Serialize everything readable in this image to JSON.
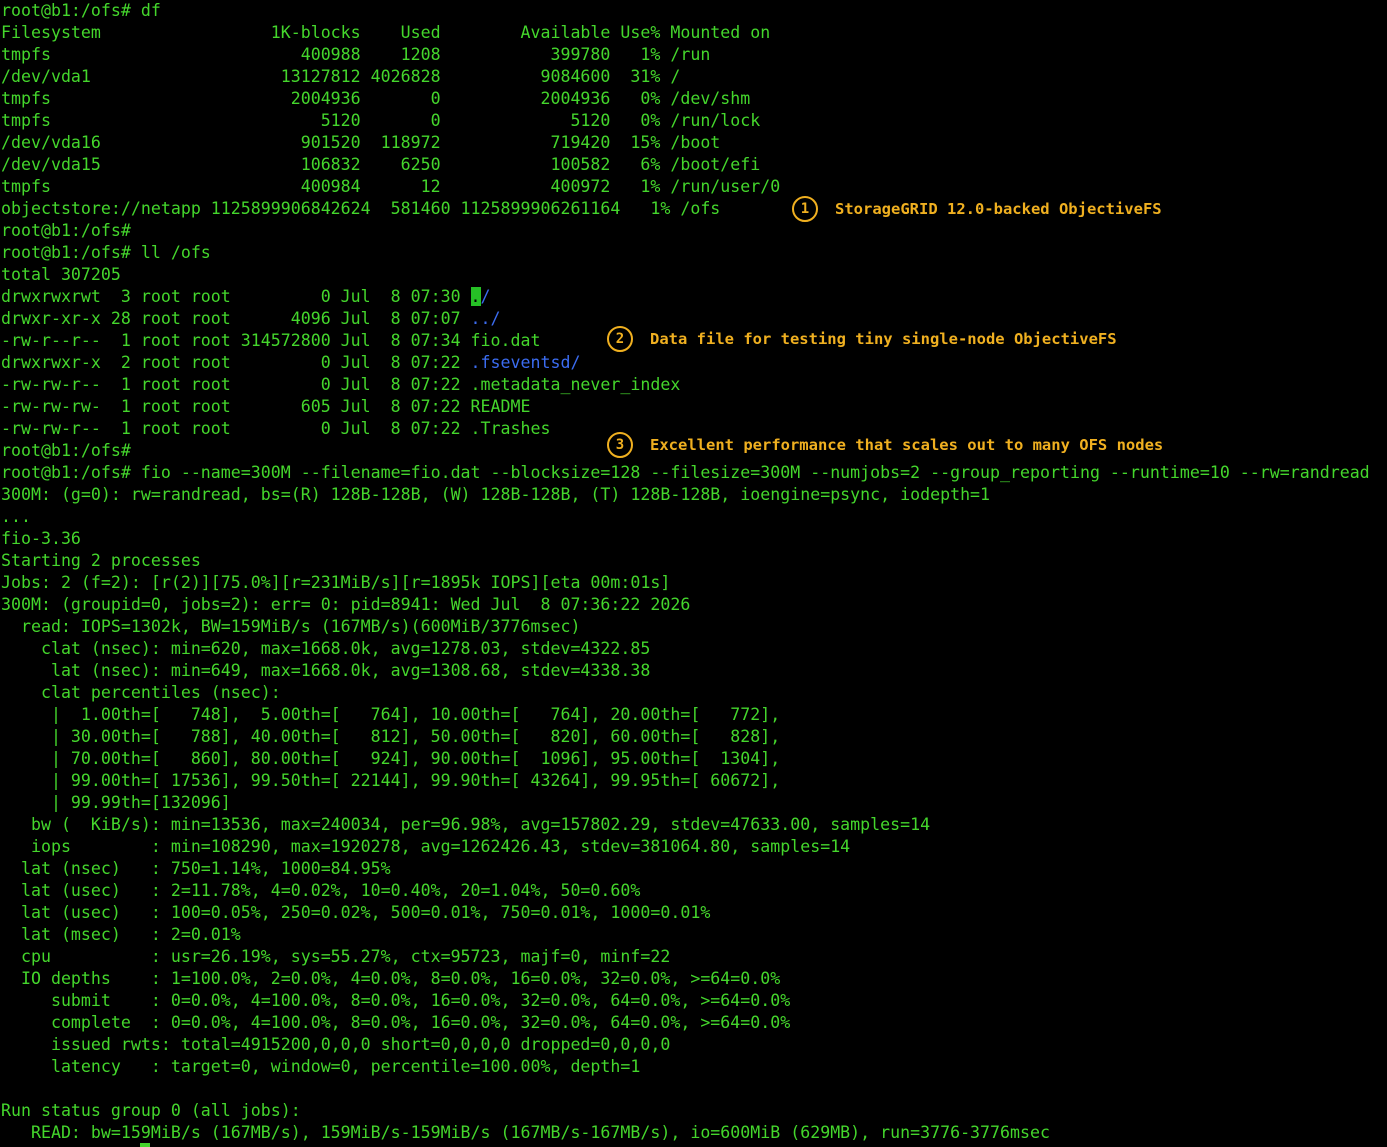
{
  "terminal": {
    "lines": [
      [
        "root@b1:/ofs# df"
      ],
      [
        "Filesystem                 1K-blocks    Used        Available Use% Mounted on"
      ],
      [
        "tmpfs                         400988    1208           399780   1% /run"
      ],
      [
        "/dev/vda1                   13127812 4026828          9084600  31% /"
      ],
      [
        "tmpfs                        2004936       0          2004936   0% /dev/shm"
      ],
      [
        "tmpfs                           5120       0             5120   0% /run/lock"
      ],
      [
        "/dev/vda16                    901520  118972           719420  15% /boot"
      ],
      [
        "/dev/vda15                    106832    6250           100582   6% /boot/efi"
      ],
      [
        "tmpfs                         400984      12           400972   1% /run/user/0"
      ],
      [
        "objectstore://netapp 1125899906842624  581460 1125899906261164   1% /ofs"
      ],
      [
        "root@b1:/ofs#"
      ],
      [
        "root@b1:/ofs# ll /ofs"
      ],
      [
        "total 307205"
      ],
      [
        "drwxrwxrwt  3 root root         0 Jul  8 07:30 ",
        {
          "t": ".",
          "c": "hl"
        },
        {
          "t": "/",
          "c": "dir"
        }
      ],
      [
        "drwxr-xr-x 28 root root      4096 Jul  8 07:07 ",
        {
          "t": "../",
          "c": "dir"
        }
      ],
      [
        "-rw-r--r--  1 root root 314572800 Jul  8 07:34 fio.dat"
      ],
      [
        "drwxrwxr-x  2 root root         0 Jul  8 07:22 ",
        {
          "t": ".fseventsd/",
          "c": "dir"
        }
      ],
      [
        "-rw-rw-r--  1 root root         0 Jul  8 07:22 .metadata_never_index"
      ],
      [
        "-rw-rw-rw-  1 root root       605 Jul  8 07:22 README"
      ],
      [
        "-rw-rw-r--  1 root root         0 Jul  8 07:22 .Trashes"
      ],
      [
        "root@b1:/ofs#"
      ],
      [
        "root@b1:/ofs# fio --name=300M --filename=fio.dat --blocksize=128 --filesize=300M --numjobs=2 --group_reporting --runtime=10 --rw=randread"
      ],
      [
        "300M: (g=0): rw=randread, bs=(R) 128B-128B, (W) 128B-128B, (T) 128B-128B, ioengine=psync, iodepth=1"
      ],
      [
        "..."
      ],
      [
        "fio-3.36"
      ],
      [
        "Starting 2 processes"
      ],
      [
        "Jobs: 2 (f=2): [r(2)][75.0%][r=231MiB/s][r=1895k IOPS][eta 00m:01s]"
      ],
      [
        "300M: (groupid=0, jobs=2): err= 0: pid=8941: Wed Jul  8 07:36:22 2026"
      ],
      [
        "  read: IOPS=1302k, BW=159MiB/s (167MB/s)(600MiB/3776msec)"
      ],
      [
        "    clat (nsec): min=620, max=1668.0k, avg=1278.03, stdev=4322.85"
      ],
      [
        "     lat (nsec): min=649, max=1668.0k, avg=1308.68, stdev=4338.38"
      ],
      [
        "    clat percentiles (nsec):"
      ],
      [
        "     |  1.00th=[   748],  5.00th=[   764], 10.00th=[   764], 20.00th=[   772],"
      ],
      [
        "     | 30.00th=[   788], 40.00th=[   812], 50.00th=[   820], 60.00th=[   828],"
      ],
      [
        "     | 70.00th=[   860], 80.00th=[   924], 90.00th=[  1096], 95.00th=[  1304],"
      ],
      [
        "     | 99.00th=[ 17536], 99.50th=[ 22144], 99.90th=[ 43264], 99.95th=[ 60672],"
      ],
      [
        "     | 99.99th=[132096]"
      ],
      [
        "   bw (  KiB/s): min=13536, max=240034, per=96.98%, avg=157802.29, stdev=47633.00, samples=14"
      ],
      [
        "   iops        : min=108290, max=1920278, avg=1262426.43, stdev=381064.80, samples=14"
      ],
      [
        "  lat (nsec)   : 750=1.14%, 1000=84.95%"
      ],
      [
        "  lat (usec)   : 2=11.78%, 4=0.02%, 10=0.40%, 20=1.04%, 50=0.60%"
      ],
      [
        "  lat (usec)   : 100=0.05%, 250=0.02%, 500=0.01%, 750=0.01%, 1000=0.01%"
      ],
      [
        "  lat (msec)   : 2=0.01%"
      ],
      [
        "  cpu          : usr=26.19%, sys=55.27%, ctx=95723, majf=0, minf=22"
      ],
      [
        "  IO depths    : 1=100.0%, 2=0.0%, 4=0.0%, 8=0.0%, 16=0.0%, 32=0.0%, >=64=0.0%"
      ],
      [
        "     submit    : 0=0.0%, 4=100.0%, 8=0.0%, 16=0.0%, 32=0.0%, 64=0.0%, >=64=0.0%"
      ],
      [
        "     complete  : 0=0.0%, 4=100.0%, 8=0.0%, 16=0.0%, 32=0.0%, 64=0.0%, >=64=0.0%"
      ],
      [
        "     issued rwts: total=4915200,0,0,0 short=0,0,0,0 dropped=0,0,0,0"
      ],
      [
        "     latency   : target=0, window=0, percentile=100.00%, depth=1"
      ],
      [
        ""
      ],
      [
        "Run status group 0 (all jobs):"
      ],
      [
        "   READ: bw=159MiB/s (167MB/s), 159MiB/s-159MiB/s (167MB/s-167MB/s), io=600MiB (629MB), run=3776-3776msec"
      ]
    ]
  },
  "callouts": [
    {
      "num": "1",
      "text": "StorageGRID 12.0-backed ObjectiveFS"
    },
    {
      "num": "2",
      "text": "Data file for testing tiny single-node ObjectiveFS"
    },
    {
      "num": "3",
      "text": "Excellent performance that scales out to many OFS nodes"
    }
  ],
  "colors": {
    "text": "#44d62c",
    "directory": "#3b6cf0",
    "callout": "#f0b020",
    "background": "#000000"
  }
}
